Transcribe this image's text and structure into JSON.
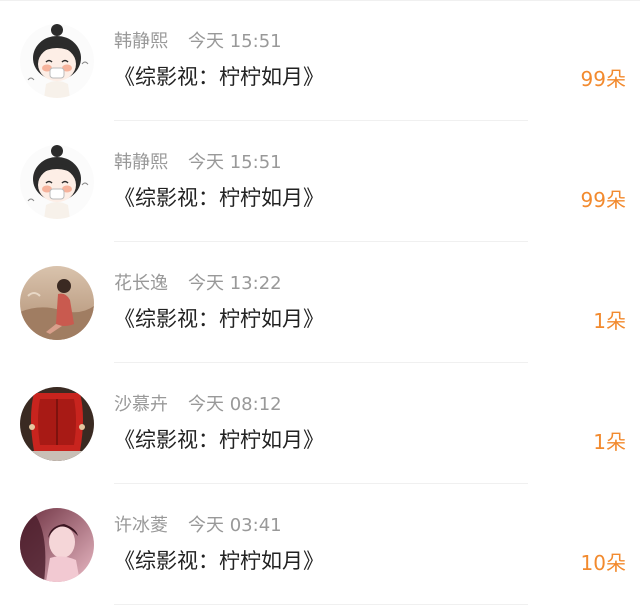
{
  "records": [
    {
      "name": "韩静熙",
      "time": "今天 15:51",
      "title": "《综影视：柠柠如月》",
      "amount": "99朵",
      "avatar_icon": "cartoon-girl-avatar-icon"
    },
    {
      "name": "韩静熙",
      "time": "今天 15:51",
      "title": "《综影视：柠柠如月》",
      "amount": "99朵",
      "avatar_icon": "cartoon-girl-avatar-icon"
    },
    {
      "name": "花长逸",
      "time": "今天 13:22",
      "title": "《综影视：柠柠如月》",
      "amount": "1朵",
      "avatar_icon": "photo-girl-sitting-avatar-icon"
    },
    {
      "name": "沙慕卉",
      "time": "今天 08:12",
      "title": "《综影视：柠柠如月》",
      "amount": "1朵",
      "avatar_icon": "red-leather-seat-avatar-icon"
    },
    {
      "name": "许冰菱",
      "time": "今天 03:41",
      "title": "《综影视：柠柠如月》",
      "amount": "10朵",
      "avatar_icon": "pink-portrait-avatar-icon"
    }
  ],
  "colors": {
    "name_text": "#999999",
    "title_text": "#222222",
    "amount_accent": "#f28a2e",
    "divider": "#f0f0f0"
  }
}
